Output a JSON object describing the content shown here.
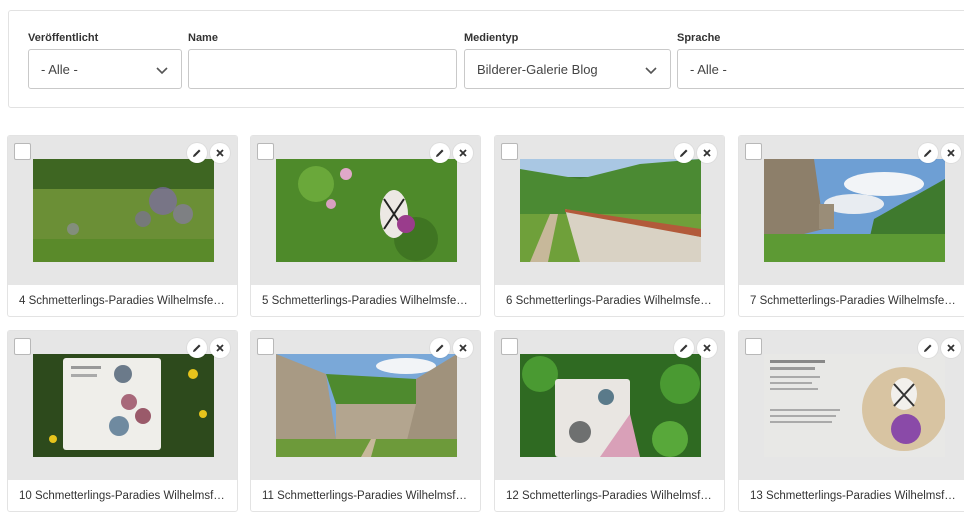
{
  "filters": {
    "published": {
      "label": "Veröffentlicht",
      "value": "- Alle -"
    },
    "name": {
      "label": "Name",
      "value": ""
    },
    "media_type": {
      "label": "Medientyp",
      "value": "Bilderer-Galerie Blog"
    },
    "language": {
      "label": "Sprache",
      "value": "- Alle -"
    }
  },
  "media": [
    {
      "caption": "4 Schmetterlings-Paradies Wilhelmsfes..."
    },
    {
      "caption": "5 Schmetterlings-Paradies Wilhelmsfes..."
    },
    {
      "caption": "6 Schmetterlings-Paradies Wilhelmsfes..."
    },
    {
      "caption": "7 Schmetterlings-Paradies Wilhelmsfes..."
    },
    {
      "caption": "10 Schmetterlings-Paradies Wilhelmsfe..."
    },
    {
      "caption": "11 Schmetterlings-Paradies Wilhelmsfe..."
    },
    {
      "caption": "12 Schmetterlings-Paradies Wilhelmsfe..."
    },
    {
      "caption": "13 Schmetterlings-Paradies Wilhelmsfe..."
    }
  ],
  "icons": {
    "edit": "pencil-icon",
    "delete": "close-icon",
    "dropdown": "chevron-down-icon"
  }
}
